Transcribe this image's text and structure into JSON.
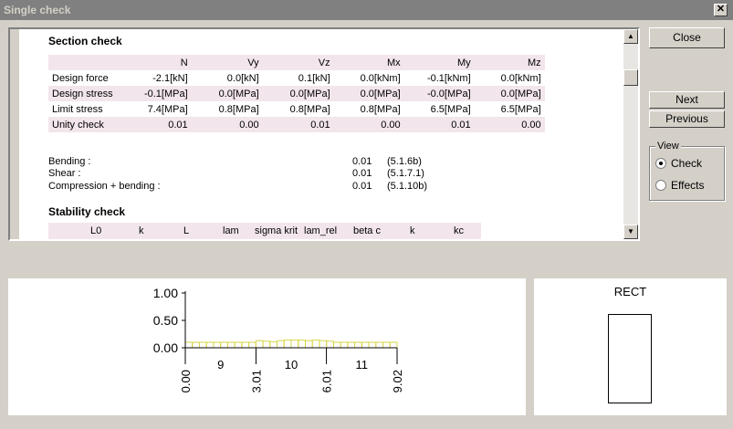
{
  "window": {
    "title": "Single check",
    "close_glyph": "✕"
  },
  "section": {
    "title": "Section  check",
    "headers": [
      "",
      "N",
      "Vy",
      "Vz",
      "Mx",
      "My",
      "Mz"
    ],
    "rows": [
      {
        "label": "Design force",
        "cells": [
          "-2.1[kN]",
          "0.0[kN]",
          "0.1[kN]",
          "0.0[kNm]",
          "-0.1[kNm]",
          "0.0[kNm]"
        ]
      },
      {
        "label": "Design stress",
        "cells": [
          "-0.1[MPa]",
          "0.0[MPa]",
          "0.0[MPa]",
          "0.0[MPa]",
          "-0.0[MPa]",
          "0.0[MPa]"
        ]
      },
      {
        "label": "Limit stress",
        "cells": [
          "7.4[MPa]",
          "0.8[MPa]",
          "0.8[MPa]",
          "0.8[MPa]",
          "6.5[MPa]",
          "6.5[MPa]"
        ]
      },
      {
        "label": "Unity check",
        "cells": [
          "0.01",
          "0.00",
          "0.01",
          "0.00",
          "0.01",
          "0.00"
        ]
      }
    ]
  },
  "results": [
    {
      "label": "Bending :",
      "value": "0.01",
      "ref": "(5.1.6b)"
    },
    {
      "label": "Shear :",
      "value": "0.01",
      "ref": "(5.1.7.1)"
    },
    {
      "label": "Compression +  bending :",
      "value": "0.01",
      "ref": "(5.1.10b)"
    }
  ],
  "stability": {
    "title": "Stability  check",
    "headers": [
      "L0",
      "k",
      "L",
      "lam",
      "sigma krit",
      "lam_rel",
      "beta c",
      "k",
      "kc"
    ]
  },
  "buttons": {
    "close": "Close",
    "next": "Next",
    "previous": "Previous"
  },
  "view": {
    "label": "View",
    "options": [
      {
        "label": "Check",
        "selected": true
      },
      {
        "label": "Effects",
        "selected": false
      }
    ]
  },
  "diagram": {
    "section_name": "RECT"
  },
  "chart_data": {
    "type": "bar",
    "title": "",
    "xlabel": "",
    "ylabel": "",
    "ylim": [
      0,
      1
    ],
    "yticks": [
      "1.00",
      "0.50",
      "0.00"
    ],
    "xticks_rotated": [
      "0.00",
      "3.01",
      "6.01",
      "9.02"
    ],
    "xticks_segments": [
      "9",
      "10",
      "11"
    ],
    "bar_color": "#d6d64a",
    "x": [
      0.0,
      0.3,
      0.6,
      0.9,
      1.2,
      1.5,
      1.8,
      2.1,
      2.4,
      2.7,
      3.0,
      3.3,
      3.6,
      3.9,
      4.2,
      4.5,
      4.8,
      5.1,
      5.4,
      5.7,
      6.0,
      6.3,
      6.6,
      6.9,
      7.2,
      7.5,
      7.8,
      8.1,
      8.4,
      8.7
    ],
    "values": [
      0.1,
      0.1,
      0.1,
      0.1,
      0.1,
      0.1,
      0.1,
      0.1,
      0.1,
      0.1,
      0.13,
      0.12,
      0.11,
      0.13,
      0.14,
      0.14,
      0.14,
      0.13,
      0.14,
      0.13,
      0.12,
      0.1,
      0.1,
      0.1,
      0.1,
      0.1,
      0.1,
      0.1,
      0.1,
      0.1
    ]
  }
}
